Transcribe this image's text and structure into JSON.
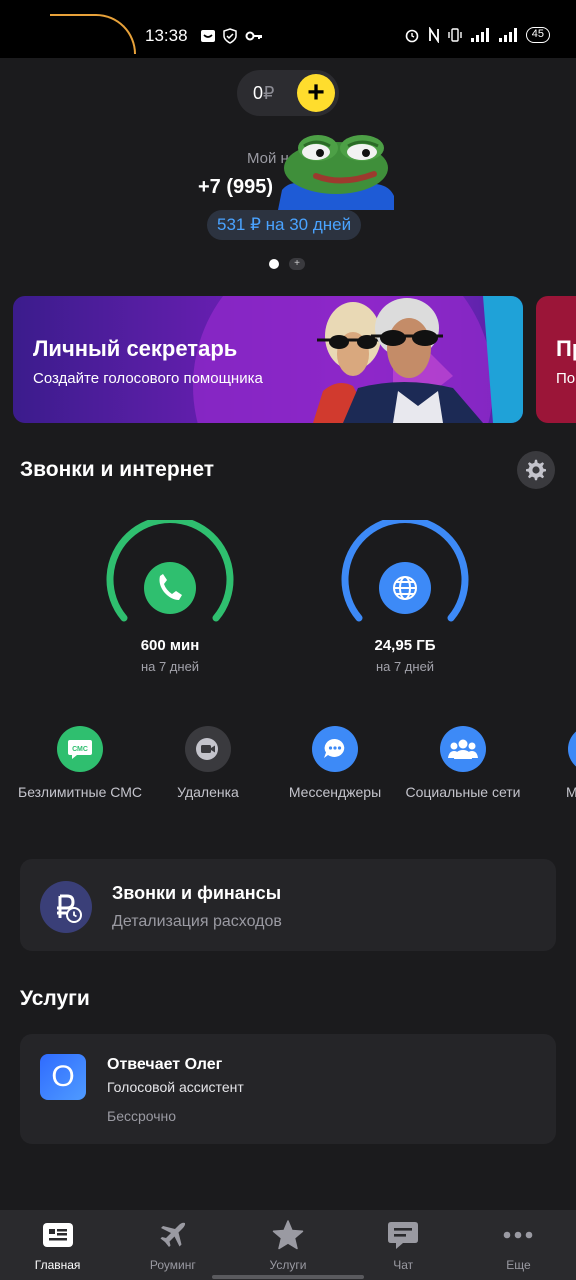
{
  "status_bar": {
    "time": "13:38",
    "battery": "45"
  },
  "balance": {
    "amount": "0",
    "currency": "₽",
    "add_label": "+"
  },
  "account": {
    "label": "Мой н",
    "phone": "+7 (995)",
    "tariff": "531 ₽ на 30 дней"
  },
  "pager": {
    "plus": "+"
  },
  "banners": [
    {
      "title": "Личный секретарь",
      "subtitle": "Создайте голосового помощника"
    },
    {
      "title": "Пр",
      "subtitle": "По"
    }
  ],
  "calls_internet": {
    "title": "Звонки и интернет",
    "gauges": [
      {
        "value": "600 мин",
        "period": "на 7 дней",
        "icon": "phone-icon",
        "color": "#2fbf6f"
      },
      {
        "value": "24,95 ГБ",
        "period": "на 7 дней",
        "icon": "globe-icon",
        "color": "#3d8af7"
      }
    ]
  },
  "options": [
    {
      "label": "Безлимитные СМС",
      "icon": "sms-icon",
      "color": "#2fbf6f"
    },
    {
      "label": "Удаленка",
      "icon": "video-icon",
      "color": "#3a3a3e"
    },
    {
      "label": "Мессенджеры",
      "icon": "chat-bubble-icon",
      "color": "#3d8af7"
    },
    {
      "label": "Социальные сети",
      "icon": "people-icon",
      "color": "#3d8af7"
    },
    {
      "label": "М",
      "icon": "more-option-icon",
      "color": "#3d8af7"
    }
  ],
  "finance_card": {
    "title": "Звонки и финансы",
    "subtitle": "Детализация расходов"
  },
  "services": {
    "title": "Услуги",
    "items": [
      {
        "title": "Отвечает Олег",
        "subtitle": "Голосовой ассистент",
        "term": "Бессрочно",
        "badge": "O"
      }
    ]
  },
  "bottom_nav": [
    {
      "label": "Главная",
      "icon": "home-icon",
      "active": true
    },
    {
      "label": "Роуминг",
      "icon": "airplane-icon",
      "active": false
    },
    {
      "label": "Услуги",
      "icon": "star-icon",
      "active": false
    },
    {
      "label": "Чат",
      "icon": "chat-icon",
      "active": false
    },
    {
      "label": "Еще",
      "icon": "more-icon",
      "active": false
    }
  ]
}
